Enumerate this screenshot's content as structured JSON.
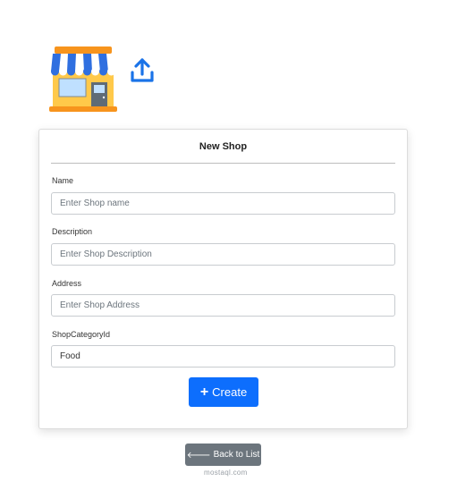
{
  "header": {
    "shop_icon": "storefront-icon",
    "upload_icon": "upload-icon"
  },
  "form": {
    "title": "New Shop",
    "fields": [
      {
        "label": "Name",
        "placeholder": "Enter Shop name",
        "value": ""
      },
      {
        "label": "Description",
        "placeholder": "Enter Shop Description",
        "value": ""
      },
      {
        "label": "Address",
        "placeholder": "Enter Shop Address",
        "value": ""
      },
      {
        "label": "ShopCategoryId",
        "placeholder": "",
        "value": "Food"
      }
    ],
    "create_label": "Create",
    "create_icon": "plus-icon"
  },
  "footer": {
    "back_label": "Back to List",
    "back_icon": "arrow-left-icon",
    "watermark": "mostaql.com"
  },
  "colors": {
    "primary": "#0d6efd",
    "secondary": "#6c757d",
    "awning_blue": "#2f6fe0",
    "shop_yellow": "#ffc94a",
    "roof_orange": "#f7941d"
  }
}
